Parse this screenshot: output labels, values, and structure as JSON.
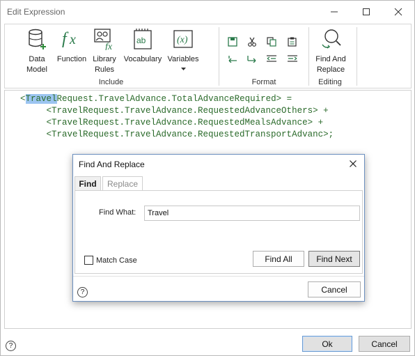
{
  "window": {
    "title": "Edit Expression",
    "controls": [
      "minimize-icon",
      "maximize-icon",
      "close-icon"
    ]
  },
  "ribbon": {
    "include": {
      "label": "Include",
      "buttons": [
        {
          "label": "Data\nModel",
          "icon": "database-add-icon"
        },
        {
          "label": "Function",
          "icon": "function-fx-icon"
        },
        {
          "label": "Library\nRules",
          "icon": "library-rules-icon"
        },
        {
          "label": "Vocabulary",
          "icon": "vocabulary-notepad-icon"
        },
        {
          "label": "Variables",
          "icon": "variables-x-icon"
        }
      ]
    },
    "format": {
      "label": "Format",
      "icons": [
        "save-icon",
        "cut-icon",
        "copy-icon",
        "paste-icon",
        "undo-icon",
        "redo-icon",
        "outdent-icon",
        "indent-icon"
      ]
    },
    "editing": {
      "label": "Editing",
      "buttons": [
        {
          "label": "Find And\nReplace",
          "icon": "find-replace-icon"
        }
      ]
    }
  },
  "editor": {
    "line1_prefix": "<",
    "line1_highlight": "Travel",
    "line1_rest": "Request.TravelAdvance.TotalAdvanceRequired> =",
    "line2": "     <TravelRequest.TravelAdvance.RequestedAdvanceOthers> +",
    "line3": "     <TravelRequest.TravelAdvance.RequestedMealsAdvance> +",
    "line4": "     <TravelRequest.TravelAdvance.RequestedTransportAdvanc>;"
  },
  "dialog": {
    "title": "Find And Replace",
    "tabs": [
      "Find",
      "Replace"
    ],
    "find_what_label": "Find What:",
    "find_what_value": "Travel",
    "match_case_label": "Match Case",
    "find_all": "Find All",
    "find_next": "Find Next",
    "cancel": "Cancel",
    "help": "?"
  },
  "footer": {
    "help": "?",
    "ok": "Ok",
    "cancel": "Cancel"
  },
  "colors": {
    "accent": "#2f7cc1",
    "code_text": "#2a6a2a",
    "selection": "#9cc5f1"
  }
}
